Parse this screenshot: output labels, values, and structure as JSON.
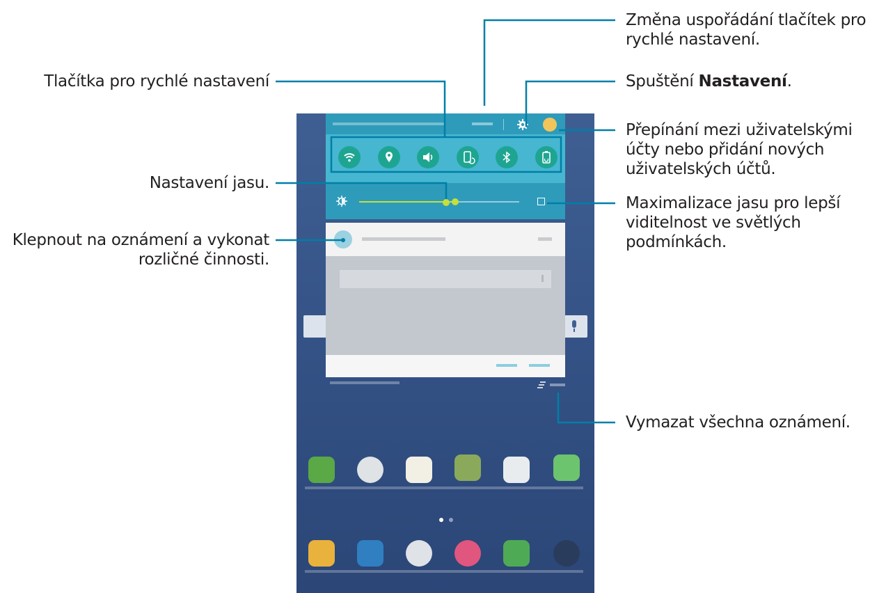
{
  "callouts": {
    "rearrange": [
      "Změna uspořádání tlačítek pro",
      "rychlé nastavení."
    ],
    "settings_prefix": "Spuštění ",
    "settings_bold": "Nastavení",
    "settings_suffix": ".",
    "users": [
      "Přepínání mezi uživatelskými",
      "účty nebo přidání nových",
      "uživatelských účtů."
    ],
    "max_brightness": [
      "Maximalizace jasu pro lepší",
      "viditelnost ve světlých",
      "podmínkách."
    ],
    "clear_all": "Vymazat všechna oznámení.",
    "quick_buttons": "Tlačítka pro rychlé nastavení",
    "brightness": "Nastavení jasu.",
    "tap_notification": [
      "Klepnout na oznámení a vykonat",
      "rozličné činnosti."
    ]
  },
  "quick_settings": {
    "buttons": [
      "wifi-icon",
      "location-icon",
      "sound-icon",
      "screen-rotation-icon",
      "bluetooth-icon",
      "power-saving-icon"
    ]
  },
  "brightness": {
    "level": 0.6
  },
  "colors": {
    "callout_line": "#007fa8",
    "panel": "#47b6d1",
    "quick_button": "#1ea592",
    "slider": "#c6df3b"
  }
}
